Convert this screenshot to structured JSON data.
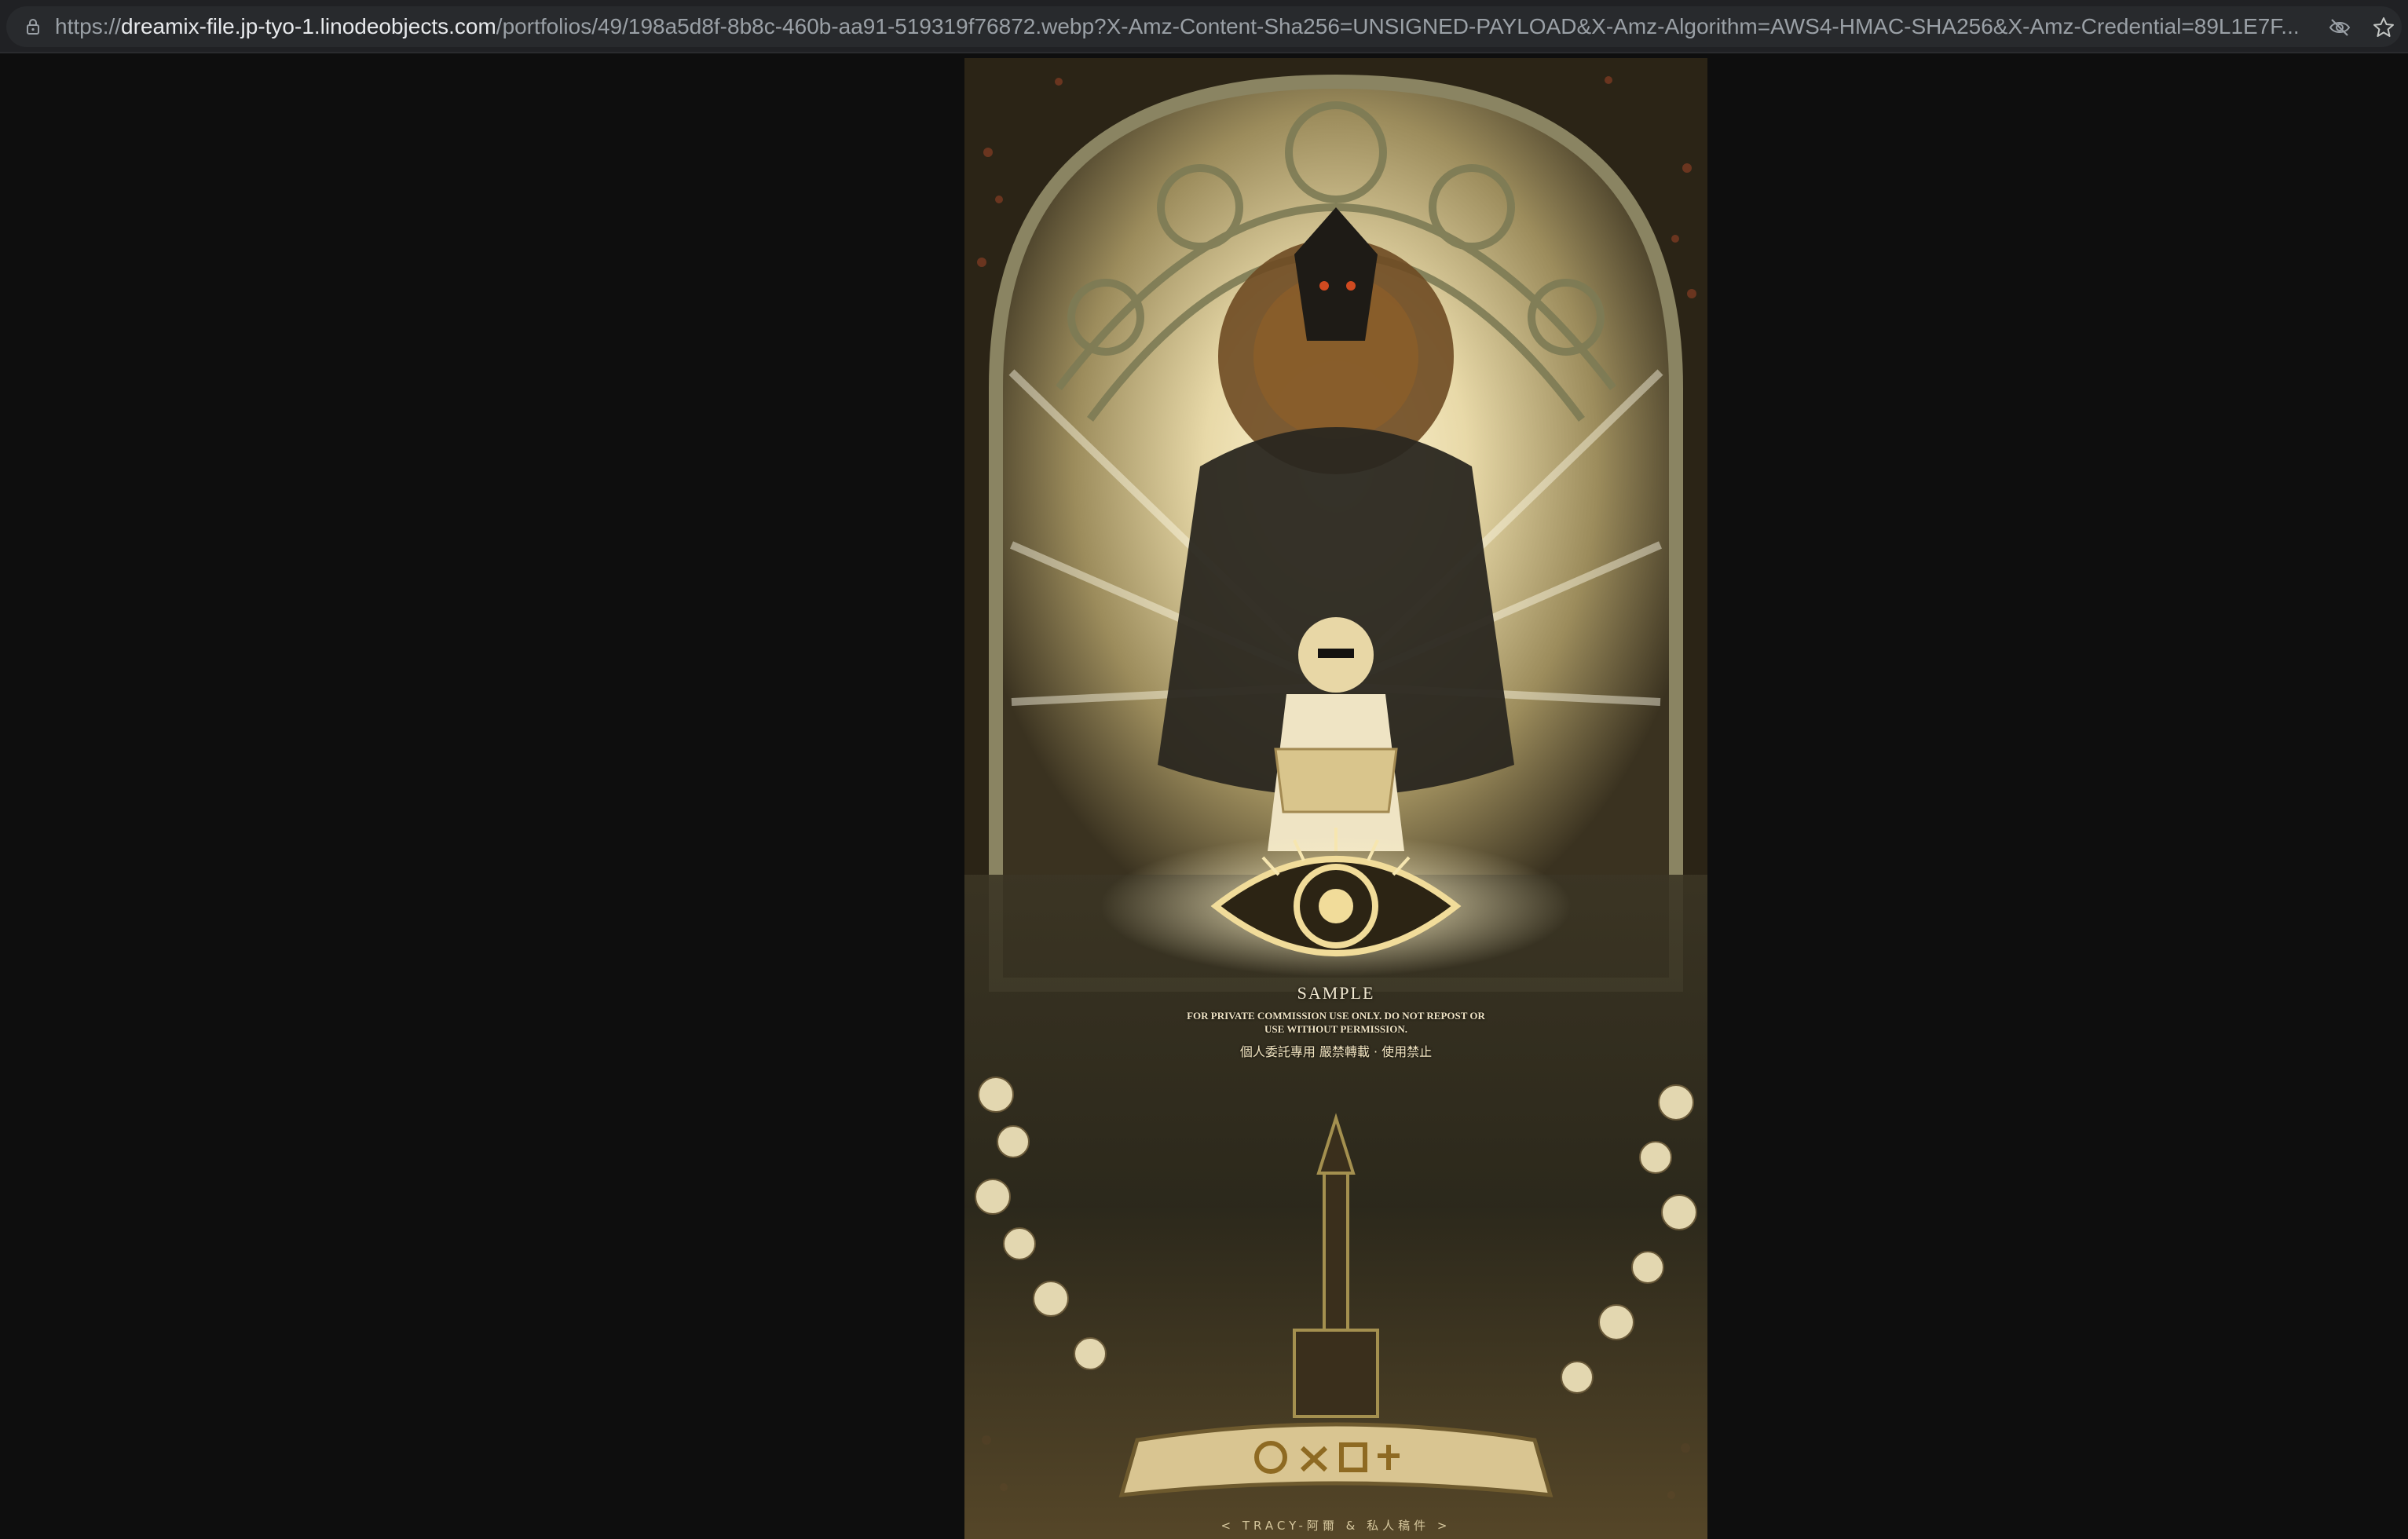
{
  "browser": {
    "address_bar": {
      "scheme": "https://",
      "host": "dreamix-file.jp-tyo-1.linodeobjects.com",
      "path": "/portfolios/49/198a5d8f-8b8c-460b-aa91-519319f76872.webp?X-Amz-Content-Sha256=UNSIGNED-PAYLOAD&X-Amz-Algorithm=AWS4-HMAC-SHA256&X-Amz-Credential=89L1E7F..."
    },
    "icons": {
      "lock": "lock-icon",
      "tracking": "eye-off-icon",
      "bookmark": "star-icon"
    }
  },
  "image": {
    "watermark_title": "SAMPLE",
    "watermark_line1": "FOR PRIVATE COMMISSION USE ONLY. DO NOT REPOST OR",
    "watermark_line2": "USE WITHOUT PERMISSION.",
    "watermark_cn": "個人委託專用 嚴禁轉載 · 使用禁止",
    "credit": "< TRACY-阿爾 & 私人稿件 >"
  },
  "colors": {
    "page_bg": "#0e0e0e",
    "toolbar_bg": "#202124",
    "omnibox_bg": "#282a2d",
    "url_host": "#e8eaed",
    "url_rest": "#9aa0a6"
  }
}
